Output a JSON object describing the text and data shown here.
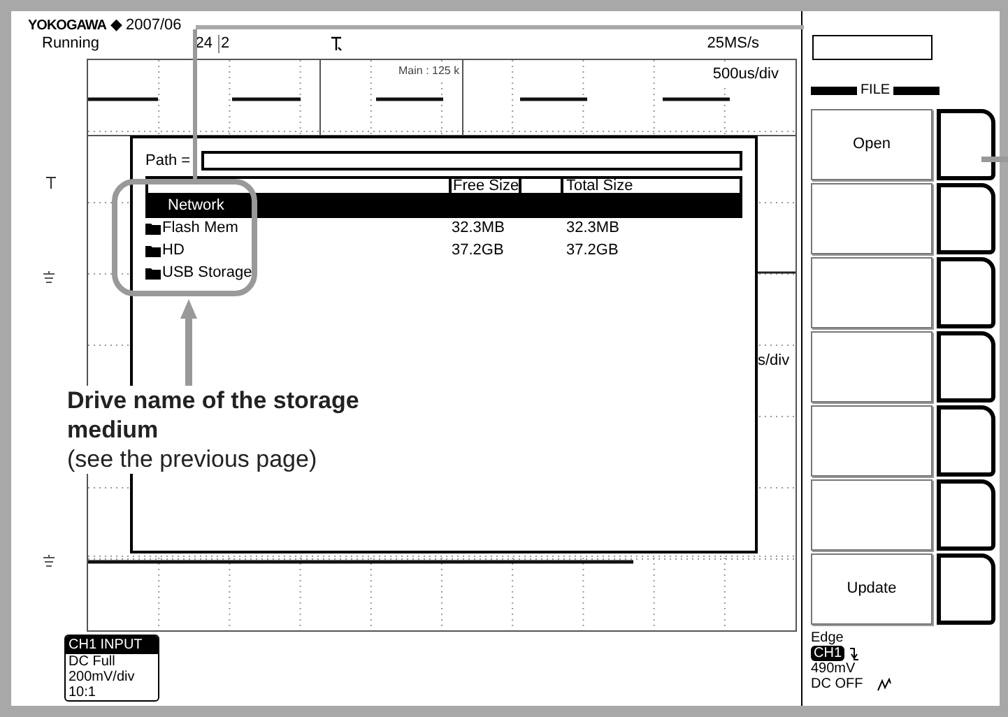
{
  "header": {
    "brand": "YOKOGAWA",
    "separator": "◆",
    "date": "2007/06",
    "status": "Running",
    "time_part": "24",
    "time_part_2": "2",
    "sample_rate": "25MS/s"
  },
  "graticule": {
    "zoom_label": "Main : 125 k",
    "timebase": "500us/div",
    "timebase_2": "s/div"
  },
  "dialog": {
    "path_label": "Path =",
    "columns": [
      "Free Size",
      "Total Size"
    ],
    "rows": [
      {
        "kind": "network",
        "name": "Network",
        "selected": true
      },
      {
        "kind": "folder",
        "name": "Flash Mem",
        "free_size": "32.3MB",
        "total_size": "32.3MB",
        "selected": false
      },
      {
        "kind": "folder",
        "name": "HD",
        "free_size": "37.2GB",
        "total_size": "37.2GB",
        "selected": false
      },
      {
        "kind": "folder",
        "name": "USB Storage",
        "selected": false
      }
    ]
  },
  "menu": {
    "title": "FILE",
    "softkeys": [
      {
        "kind": "labeled",
        "label": "Open"
      },
      {
        "kind": "blank"
      },
      {
        "kind": "blank"
      },
      {
        "kind": "blank"
      },
      {
        "kind": "blank"
      },
      {
        "kind": "blank"
      },
      {
        "kind": "labeled",
        "label": "Update"
      }
    ]
  },
  "channel_info": {
    "title": "CH1 INPUT",
    "lines": [
      "DC Full",
      "200mV/div",
      "10:1"
    ]
  },
  "trigger": {
    "mode": "Edge",
    "source": "CH1",
    "trigger_level": "490mV",
    "coupling": "DC OFF"
  },
  "annotation": {
    "title": "Drive name of the storage medium",
    "note": "(see the previous page)"
  }
}
